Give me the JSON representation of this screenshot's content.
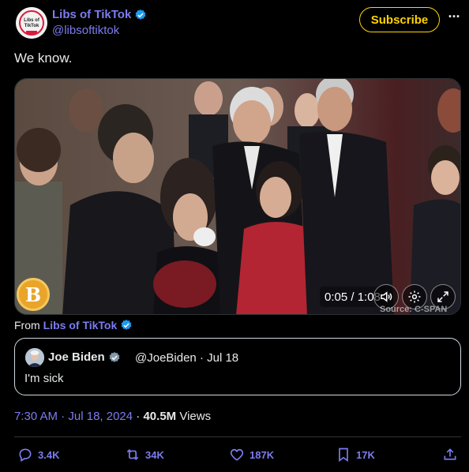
{
  "author": {
    "display_name": "Libs of TikTok",
    "handle": "@libsoftiktok",
    "avatar_text": "Libs of TikTok"
  },
  "subscribe_label": "Subscribe",
  "more_label": "···",
  "tweet_text": "We know.",
  "video": {
    "timestamp": "0:05 / 1:08",
    "source_label": "Source: C-SPAN",
    "badge_letter": "B"
  },
  "from": {
    "prefix": "From",
    "account": "Libs of TikTok"
  },
  "quote": {
    "name": "Joe Biden",
    "handle_date": "@JoeBiden · Jul 18",
    "text": "I'm sick"
  },
  "meta": {
    "time": "7:30 AM",
    "date": "Jul 18, 2024",
    "views_count": "40.5M",
    "views_label": "Views"
  },
  "actions": {
    "replies": "3.4K",
    "reposts": "34K",
    "likes": "187K",
    "bookmarks": "17K"
  },
  "colors": {
    "accent": "#7c7cf0",
    "subscribe": "#ffd400",
    "background": "#000000"
  }
}
